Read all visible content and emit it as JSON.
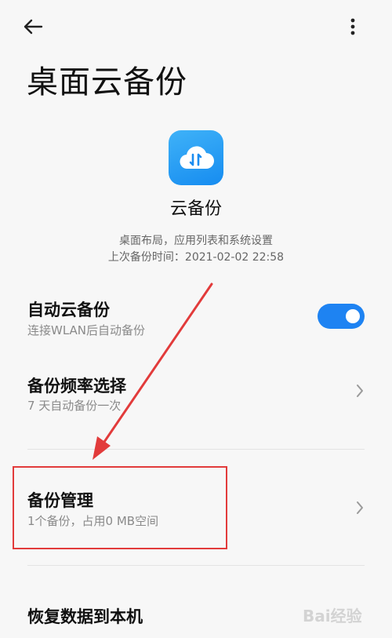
{
  "header": {
    "back_icon": "arrow-left-icon",
    "more_icon": "more-vertical-icon"
  },
  "page": {
    "title": "桌面云备份"
  },
  "app": {
    "icon": "cloud-sync-icon",
    "name": "云备份",
    "description_line1": "桌面布局，应用列表和系统设置",
    "description_line2": "上次备份时间：2021-02-02 22:58"
  },
  "settings": {
    "auto_backup": {
      "title": "自动云备份",
      "subtitle": "连接WLAN后自动备份",
      "toggle_on": true
    },
    "frequency": {
      "title": "备份频率选择",
      "subtitle": "7 天自动备份一次"
    },
    "manage": {
      "title": "备份管理",
      "subtitle": "1个备份，占用0 MB空间"
    },
    "restore": {
      "title": "恢复数据到本机"
    }
  },
  "colors": {
    "accent": "#1e83f2",
    "annotation": "#e23b3b",
    "background": "#f7f7f7"
  },
  "watermark": {
    "text": "Bai经验"
  }
}
